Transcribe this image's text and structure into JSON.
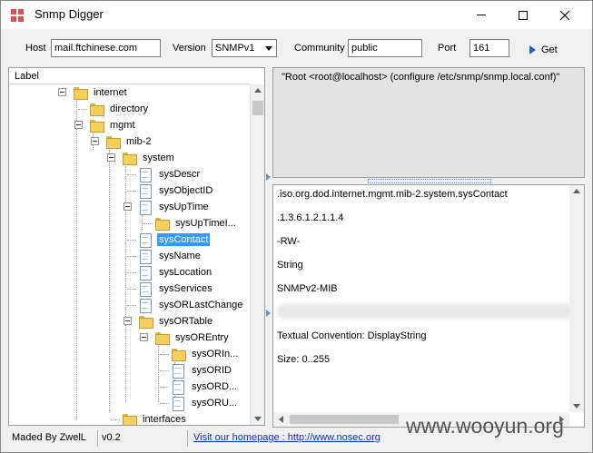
{
  "window": {
    "title": "Snmp Digger",
    "minimize_label": "minimize",
    "maximize_label": "maximize",
    "close_label": "close"
  },
  "toolbar": {
    "host_label": "Host",
    "host_value": "mail.ftchinese.com",
    "version_label": "Version",
    "version_value": "SNMPv1",
    "community_label": "Community",
    "community_value": "public",
    "port_label": "Port",
    "port_value": "161",
    "get_label": "Get"
  },
  "tree": {
    "header": "Label",
    "nodes": [
      {
        "label": "internet",
        "type": "folder"
      },
      {
        "label": "directory",
        "type": "folder"
      },
      {
        "label": "mgmt",
        "type": "folder"
      },
      {
        "label": "mib-2",
        "type": "folder"
      },
      {
        "label": "system",
        "type": "folder"
      },
      {
        "label": "sysDescr",
        "type": "leaf"
      },
      {
        "label": "sysObjectID",
        "type": "leaf"
      },
      {
        "label": "sysUpTime",
        "type": "leaf"
      },
      {
        "label": "sysUpTimeI...",
        "type": "folder"
      },
      {
        "label": "sysContact",
        "type": "leaf",
        "selected": true
      },
      {
        "label": "sysName",
        "type": "leaf"
      },
      {
        "label": "sysLocation",
        "type": "leaf"
      },
      {
        "label": "sysServices",
        "type": "leaf"
      },
      {
        "label": "sysORLastChange",
        "type": "leaf"
      },
      {
        "label": "sysORTable",
        "type": "folder"
      },
      {
        "label": "sysOREntry",
        "type": "folder"
      },
      {
        "label": "sysORIn...",
        "type": "folder"
      },
      {
        "label": "sysORID",
        "type": "leaf"
      },
      {
        "label": "sysORD...",
        "type": "leaf"
      },
      {
        "label": "sysORU...",
        "type": "leaf"
      },
      {
        "label": "interfaces",
        "type": "folder"
      }
    ]
  },
  "result": {
    "description": "\"Root <root@localhost> (configure /etc/snmp/snmp.local.conf)\""
  },
  "detail": {
    "oid_name": ".iso.org.dod.internet.mgmt.mib-2.system.sysContact",
    "oid_number": ".1.3.6.1.2.1.1.4",
    "access": "-RW-",
    "syntax": "String",
    "module": "SNMPv2-MIB",
    "textual_convention": "Textual Convention: DisplayString",
    "size": "Size: 0..255"
  },
  "status": {
    "author": "Maded By ZwelL",
    "version": "v0.2",
    "homepage": "Visit our homepage : http://www.nosec.org"
  },
  "watermark": "www.wooyun.org",
  "colors": {
    "selection": "#3399ff",
    "link": "#0033cc",
    "folder": "#f5cf5b"
  }
}
